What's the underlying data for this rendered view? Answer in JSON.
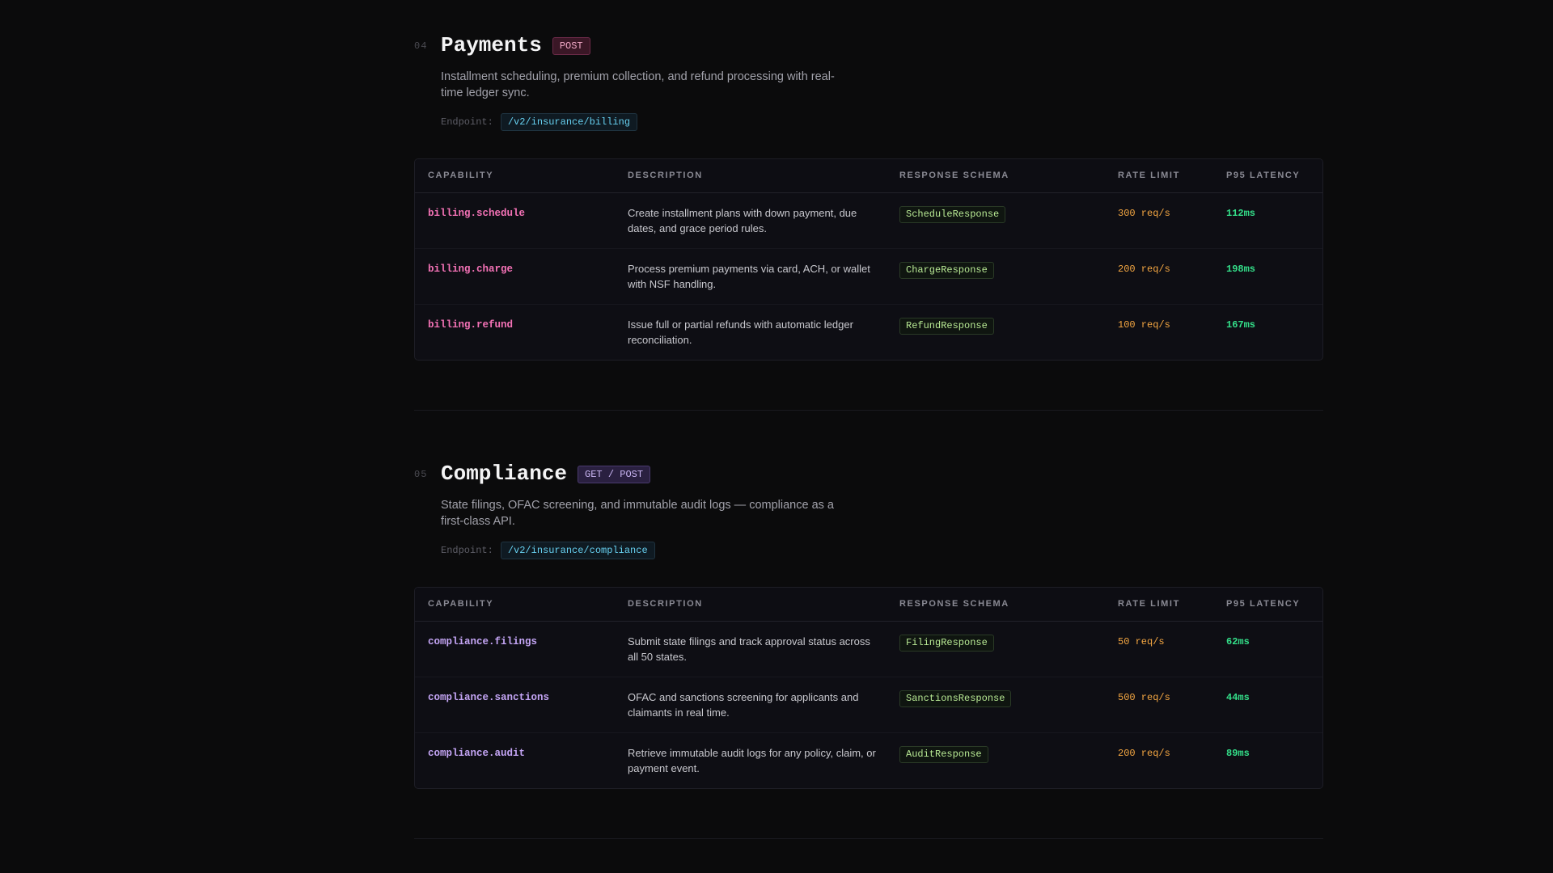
{
  "sections": [
    {
      "number": "04",
      "title": "Payments",
      "method": "POST",
      "description": "Installment scheduling, premium collection, and refund processing with real-time ledger sync.",
      "endpoint_label": "Endpoint:",
      "endpoint": "/v2/insurance/billing",
      "columns": [
        "CAPABILITY",
        "DESCRIPTION",
        "RESPONSE SCHEMA",
        "RATE LIMIT",
        "P95 LATENCY"
      ],
      "rows": [
        {
          "capability": "billing.schedule",
          "description": "Create installment plans with down payment, due dates, and grace period rules.",
          "schema": "ScheduleResponse",
          "rate_limit": "300 req/s",
          "latency": "112ms"
        },
        {
          "capability": "billing.charge",
          "description": "Process premium payments via card, ACH, or wallet with NSF handling.",
          "schema": "ChargeResponse",
          "rate_limit": "200 req/s",
          "latency": "198ms"
        },
        {
          "capability": "billing.refund",
          "description": "Issue full or partial refunds with automatic ledger reconciliation.",
          "schema": "RefundResponse",
          "rate_limit": "100 req/s",
          "latency": "167ms"
        }
      ]
    },
    {
      "number": "05",
      "title": "Compliance",
      "method": "GET / POST",
      "description": "State filings, OFAC screening, and immutable audit logs — compliance as a first-class API.",
      "endpoint_label": "Endpoint:",
      "endpoint": "/v2/insurance/compliance",
      "columns": [
        "CAPABILITY",
        "DESCRIPTION",
        "RESPONSE SCHEMA",
        "RATE LIMIT",
        "P95 LATENCY"
      ],
      "rows": [
        {
          "capability": "compliance.filings",
          "description": "Submit state filings and track approval status across all 50 states.",
          "schema": "FilingResponse",
          "rate_limit": "50 req/s",
          "latency": "62ms"
        },
        {
          "capability": "compliance.sanctions",
          "description": "OFAC and sanctions screening for applicants and claimants in real time.",
          "schema": "SanctionsResponse",
          "rate_limit": "500 req/s",
          "latency": "44ms"
        },
        {
          "capability": "compliance.audit",
          "description": "Retrieve immutable audit logs for any policy, claim, or payment event.",
          "schema": "AuditResponse",
          "rate_limit": "200 req/s",
          "latency": "89ms"
        }
      ]
    }
  ],
  "colors": {
    "background": "#0b0b0c",
    "payments_capability": "#f472b6",
    "compliance_capability": "#c4a5f5",
    "rate_limit": "#f5a742",
    "latency": "#34e08a",
    "schema": "#b8e994",
    "endpoint": "#67d0f0"
  }
}
